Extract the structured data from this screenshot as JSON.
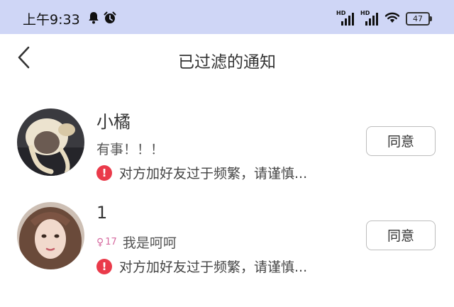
{
  "status_bar": {
    "time": "上午9:33",
    "left_icons": [
      "bell-icon",
      "alarm-icon"
    ],
    "signal_label": "HD",
    "battery": "47"
  },
  "header": {
    "title": "已过滤的通知",
    "back_icon": "chevron-left-icon"
  },
  "notifications": [
    {
      "name": "小橘",
      "message": "有事！！！",
      "warning": "对方加好友过于频繁，请谨慎...",
      "button": "同意"
    },
    {
      "name": "1",
      "gender_symbol": "♀",
      "age": "17",
      "message": "我是呵呵",
      "warning": "对方加好友过于频繁，请谨慎...",
      "button": "同意"
    }
  ],
  "colors": {
    "status_bar_bg": "#cfd6f6",
    "warning_red": "#ea3a4a",
    "female_pink": "#d66ba0"
  }
}
